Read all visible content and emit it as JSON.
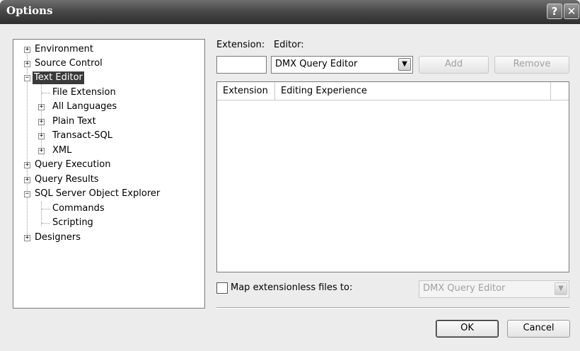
{
  "window": {
    "title": "Options",
    "help_glyph": "?",
    "close_glyph": "✕"
  },
  "tree": {
    "items": [
      {
        "label": "Environment",
        "expander": "+"
      },
      {
        "label": "Source Control",
        "expander": "+"
      },
      {
        "label": "Text Editor",
        "expander": "−",
        "selected": true
      },
      {
        "label": "File Extension"
      },
      {
        "label": "All Languages",
        "expander": "+"
      },
      {
        "label": "Plain Text",
        "expander": "+"
      },
      {
        "label": "Transact-SQL",
        "expander": "+"
      },
      {
        "label": "XML",
        "expander": "+"
      },
      {
        "label": "Query Execution",
        "expander": "+"
      },
      {
        "label": "Query Results",
        "expander": "+"
      },
      {
        "label": "SQL Server Object Explorer",
        "expander": "−"
      },
      {
        "label": "Commands"
      },
      {
        "label": "Scripting"
      },
      {
        "label": "Designers",
        "expander": "+"
      }
    ]
  },
  "form": {
    "extension_label": "Extension:",
    "extension_value": "",
    "editor_label": "Editor:",
    "editor_value": "DMX Query Editor",
    "add_label": "Add",
    "remove_label": "Remove"
  },
  "table": {
    "columns": [
      "Extension",
      "Editing Experience"
    ],
    "rows": []
  },
  "map": {
    "label": "Map extensionless files to:",
    "checked": false,
    "value": "DMX Query Editor"
  },
  "buttons": {
    "ok": "OK",
    "cancel": "Cancel"
  },
  "icons": {
    "dropdown": "chevron-down-icon",
    "dropdown_glyph": "▼"
  }
}
